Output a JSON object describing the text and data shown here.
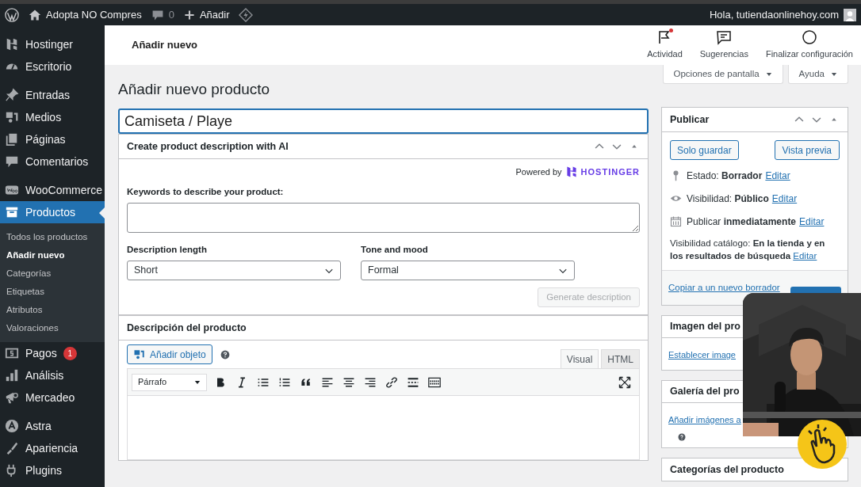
{
  "admin_bar": {
    "site": "Adopta NO Compres",
    "comments": "0",
    "new": "Añadir",
    "greeting": "Hola, tutiendaonlinehoy.com"
  },
  "header": {
    "title": "Añadir nuevo",
    "actions": [
      {
        "label": "Actividad",
        "notify": true
      },
      {
        "label": "Sugerencias",
        "notify": false
      },
      {
        "label": "Finalizar configuración",
        "notify": false
      }
    ]
  },
  "sidebar": {
    "items": [
      {
        "label": "Hostinger",
        "selected": false
      },
      {
        "label": "Escritorio",
        "selected": false
      },
      {
        "label": "Entradas",
        "selected": false
      },
      {
        "label": "Medios",
        "selected": false
      },
      {
        "label": "Páginas",
        "selected": false
      },
      {
        "label": "Comentarios",
        "selected": false
      },
      {
        "label": "WooCommerce",
        "selected": false
      },
      {
        "label": "Productos",
        "selected": true,
        "children": [
          {
            "label": "Todos los productos",
            "selected": false
          },
          {
            "label": "Añadir nuevo",
            "selected": true
          },
          {
            "label": "Categorías",
            "selected": false
          },
          {
            "label": "Etiquetas",
            "selected": false
          },
          {
            "label": "Atributos",
            "selected": false
          },
          {
            "label": "Valoraciones",
            "selected": false
          }
        ]
      },
      {
        "label": "Pagos",
        "selected": false,
        "badge": "1"
      },
      {
        "label": "Análisis",
        "selected": false
      },
      {
        "label": "Mercadeo",
        "selected": false
      },
      {
        "label": "Astra",
        "selected": false
      },
      {
        "label": "Apariencia",
        "selected": false
      },
      {
        "label": "Plugins",
        "selected": false
      }
    ]
  },
  "screen_tabs": [
    "Opciones de pantalla",
    "Ayuda"
  ],
  "page_title": "Añadir nuevo producto",
  "product_title": "Camiseta / Playe",
  "ai_box": {
    "title": "Create product description with AI",
    "powered_by": "Powered by",
    "brand": "HOSTINGER",
    "keywords_label": "Keywords to describe your product:",
    "length_label": "Description length",
    "length_value": "Short",
    "tone_label": "Tone and mood",
    "tone_value": "Formal",
    "generate": "Generate description",
    "generate_disabled": true
  },
  "description_box": {
    "title": "Descripción del producto",
    "add_media": "Añadir objeto",
    "tabs": [
      {
        "label": "Visual",
        "selected": true
      },
      {
        "label": "HTML",
        "selected": false
      }
    ],
    "format": "Párrafo"
  },
  "publish": {
    "title": "Publicar",
    "save": "Solo guardar",
    "preview": "Vista previa",
    "rows": [
      {
        "label": "Estado:",
        "value": "Borrador",
        "link": "Editar"
      },
      {
        "label": "Visibilidad:",
        "value": "Público",
        "link": "Editar"
      },
      {
        "label": "Publicar",
        "value": "inmediatamente",
        "link": "Editar"
      }
    ],
    "catalog": "Visibilidad catálogo: **En la tienda y en los resultados de búsqueda**",
    "catalog_link": "Editar",
    "copy": "Copiar a un nuevo borrador"
  },
  "side_boxes": [
    {
      "title": "Imagen del pro",
      "link": "Establecer image",
      "help": false
    },
    {
      "title": "Galería del pro",
      "link": "Añadir imágenes a",
      "help": true
    },
    {
      "title": "Categorías del producto",
      "help": false
    }
  ]
}
